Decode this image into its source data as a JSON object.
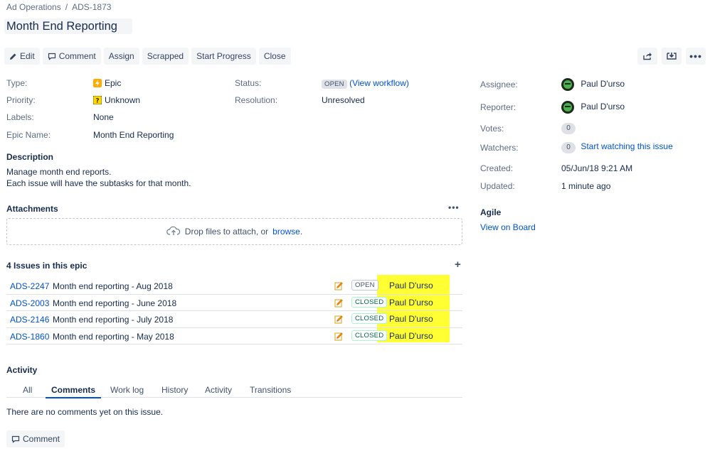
{
  "breadcrumb": {
    "project": "Ad Operations",
    "separator": "/",
    "issue_key": "ADS-1873"
  },
  "title": "Month End Reporting",
  "toolbar": {
    "edit": "Edit",
    "comment": "Comment",
    "assign": "Assign",
    "scrapped": "Scrapped",
    "start_progress": "Start Progress",
    "close": "Close"
  },
  "details": {
    "type_label": "Type:",
    "type_value": "Epic",
    "priority_label": "Priority:",
    "priority_value": "Unknown",
    "labels_label": "Labels:",
    "labels_value": "None",
    "epic_name_label": "Epic Name:",
    "epic_name_value": "Month End Reporting",
    "status_label": "Status:",
    "status_value": "OPEN",
    "view_workflow_open": "(",
    "view_workflow": "View workflow",
    "view_workflow_close": ")",
    "resolution_label": "Resolution:",
    "resolution_value": "Unresolved"
  },
  "description": {
    "heading": "Description",
    "line1": "Manage month end reports.",
    "line2": "Each issue will have the subtasks for that month."
  },
  "attachments": {
    "heading": "Attachments",
    "drop_text": "Drop files to attach, or",
    "browse": "browse."
  },
  "epic_issues": {
    "heading": "4 Issues in this epic",
    "rows": [
      {
        "key": "ADS-2247",
        "summary": "Month end reporting - Aug 2018",
        "status": "OPEN",
        "assignee": "Paul D'urso"
      },
      {
        "key": "ADS-2003",
        "summary": "Month end reporting - June 2018",
        "status": "CLOSED",
        "assignee": "Paul D'urso"
      },
      {
        "key": "ADS-2146",
        "summary": "Month end reporting - July 2018",
        "status": "CLOSED",
        "assignee": "Paul D'urso"
      },
      {
        "key": "ADS-1860",
        "summary": "Month end reporting - May 2018",
        "status": "CLOSED",
        "assignee": "Paul D'urso"
      }
    ]
  },
  "activity": {
    "heading": "Activity",
    "tabs": [
      "All",
      "Comments",
      "Work log",
      "History",
      "Activity",
      "Transitions"
    ],
    "active_tab": "Comments",
    "empty": "There are no comments yet on this issue.",
    "comment_button": "Comment"
  },
  "people": {
    "assignee_label": "Assignee:",
    "assignee": "Paul D'urso",
    "reporter_label": "Reporter:",
    "reporter": "Paul D'urso",
    "votes_label": "Votes:",
    "votes": "0",
    "watchers_label": "Watchers:",
    "watchers": "0",
    "watch_link": "Start watching this issue",
    "created_label": "Created:",
    "created": "05/Jun/18 9:21 AM",
    "updated_label": "Updated:",
    "updated": "1 minute ago"
  },
  "agile": {
    "heading": "Agile",
    "link": "View on Board"
  },
  "colors": {
    "link": "#0052cc",
    "highlight": "#ffff33",
    "text": "#172b4d",
    "muted": "#5e6c84"
  }
}
